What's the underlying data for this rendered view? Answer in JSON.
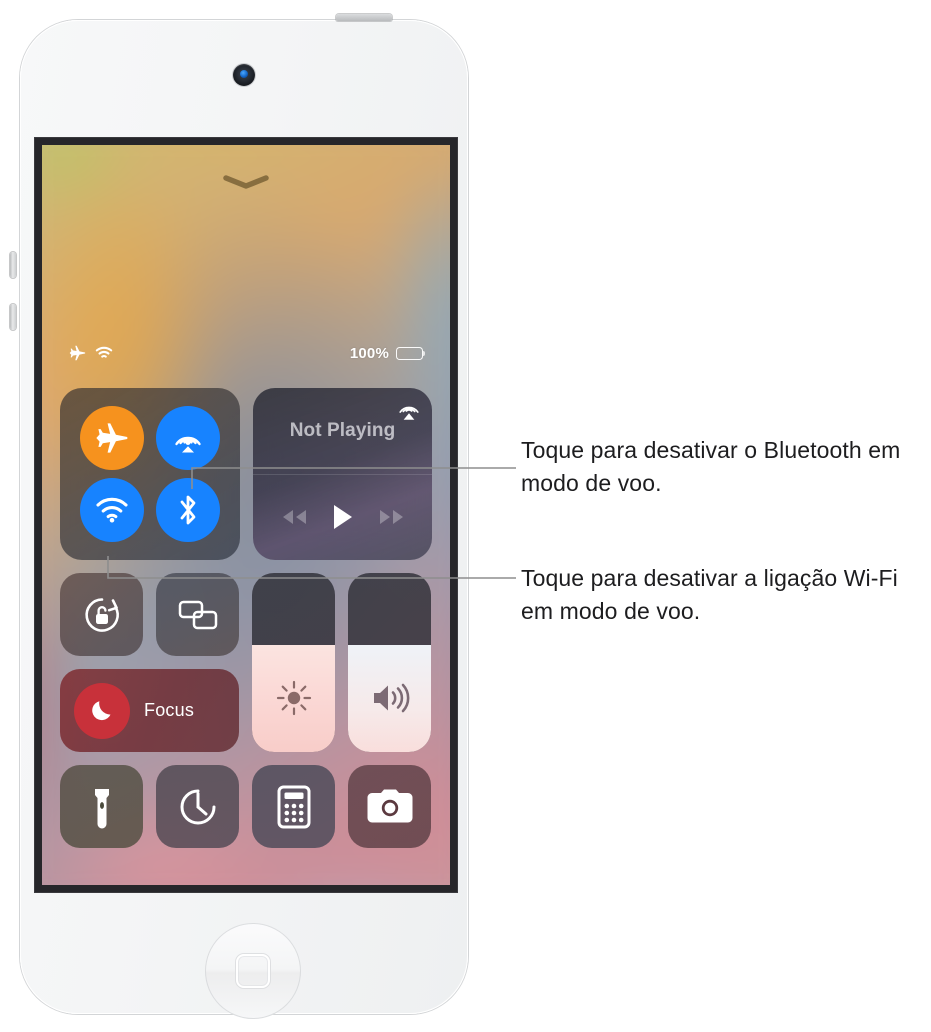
{
  "device": {
    "name": "iPod touch",
    "camera": "front-camera",
    "home_button": "home-button"
  },
  "screen": {
    "grabber": "chevron-down-grabber",
    "status_bar": {
      "airplane_icon": "airplane-icon",
      "wifi_icon": "wifi-icon",
      "battery_percent": "100%",
      "battery_icon": "battery-full-icon"
    }
  },
  "control_center": {
    "connectivity": {
      "airplane": {
        "label": "Airplane Mode",
        "state": "on",
        "color": "#f6921e",
        "icon": "airplane-icon"
      },
      "airdrop": {
        "label": "AirDrop",
        "state": "on",
        "color": "#1783ff",
        "icon": "airdrop-icon"
      },
      "wifi": {
        "label": "Wi-Fi",
        "state": "on",
        "color": "#1783ff",
        "icon": "wifi-icon"
      },
      "bluetooth": {
        "label": "Bluetooth",
        "state": "on",
        "color": "#1783ff",
        "icon": "bluetooth-icon"
      }
    },
    "now_playing": {
      "title": "Not Playing",
      "airplay_icon": "airplay-icon",
      "rewind_icon": "rewind-icon",
      "play_icon": "play-icon",
      "forward_icon": "fast-forward-icon"
    },
    "tiles": {
      "rotation_lock": {
        "label": "Rotation Lock",
        "icon": "rotation-lock-icon"
      },
      "screen_mirroring": {
        "label": "Screen Mirroring",
        "icon": "screen-mirroring-icon"
      },
      "flashlight": {
        "label": "Flashlight",
        "icon": "flashlight-icon"
      },
      "timer": {
        "label": "Timer",
        "icon": "timer-icon"
      },
      "calculator": {
        "label": "Calculator",
        "icon": "calculator-icon"
      },
      "camera": {
        "label": "Camera",
        "icon": "camera-icon"
      }
    },
    "focus": {
      "label": "Focus",
      "icon": "moon-icon",
      "color": "#c8313a"
    },
    "brightness": {
      "label": "Brightness",
      "icon": "brightness-icon",
      "value": 60
    },
    "volume": {
      "label": "Volume",
      "icon": "volume-icon",
      "value": 60
    }
  },
  "callouts": {
    "bluetooth": "Toque para desativar o Bluetooth em modo de voo.",
    "wifi": "Toque para desativar a ligação Wi-Fi em modo de voo."
  }
}
